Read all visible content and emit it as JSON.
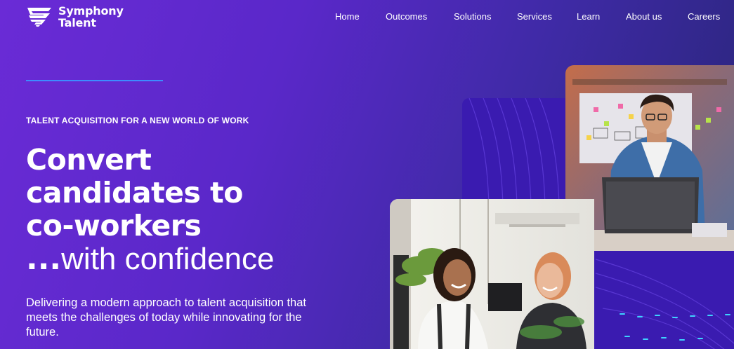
{
  "brand": {
    "name_line1": "Symphony",
    "name_line2": "Talent"
  },
  "nav": {
    "items": [
      {
        "label": "Home"
      },
      {
        "label": "Outcomes"
      },
      {
        "label": "Solutions"
      },
      {
        "label": "Services"
      },
      {
        "label": "Learn"
      },
      {
        "label": "About us"
      },
      {
        "label": "Careers"
      }
    ]
  },
  "hero": {
    "eyebrow": "TALENT ACQUISITION FOR A NEW WORLD OF WORK",
    "headline_line1": "Convert",
    "headline_line2": "candidates to",
    "headline_line3": "co-workers",
    "tagline_prefix": "...",
    "tagline_rest": "with confidence",
    "description": "Delivering a modern approach to talent acquisition that meets the challenges of today while innovating for the future."
  },
  "colors": {
    "background_start": "#6a2bd6",
    "background_end": "#272575",
    "accent_rule": "#3d8cff",
    "panel": "#3a1bb0"
  },
  "images": {
    "photo_top": "man-at-laptop-whiteboard-photo",
    "photo_bottom": "two-women-laughing-office-photo"
  }
}
